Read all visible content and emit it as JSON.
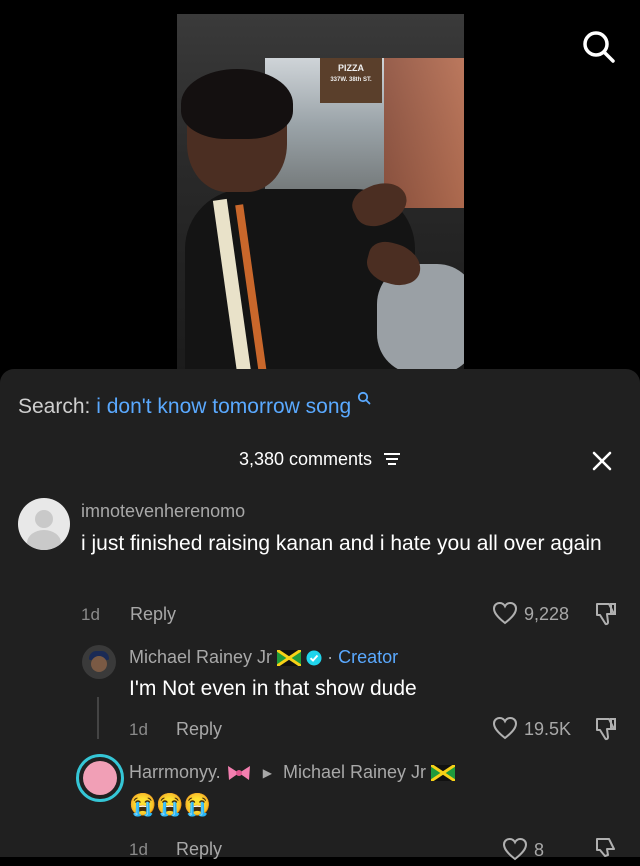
{
  "search": {
    "label": "Search:",
    "query": "i don't know tomorrow song"
  },
  "video": {
    "storefront_text": "PIZZA",
    "storefront_sub": "337W. 38th ST."
  },
  "header": {
    "comment_count": "3,380 comments"
  },
  "comments": [
    {
      "username": "imnotevenherenomo",
      "text": "i just finished raising kanan and i hate you all over again",
      "age": "1d",
      "reply_label": "Reply",
      "likes": "9,228"
    },
    {
      "username": "Michael Rainey Jr",
      "badge": "Creator",
      "text": "I'm Not even in that show dude",
      "age": "1d",
      "reply_label": "Reply",
      "likes": "19.5K"
    },
    {
      "username": "Harrmonyy.",
      "reply_to": "Michael Rainey Jr",
      "text": "😭😭😭",
      "age": "1d",
      "reply_label": "Reply",
      "likes": "8"
    }
  ],
  "icons": {
    "search": "search-icon",
    "sort": "sort-icon",
    "close": "close-icon",
    "heart": "heart-icon",
    "dislike": "dislike-icon",
    "verified": "verified-icon",
    "flag": "jamaica-flag-icon",
    "bow": "pink-bow-icon"
  },
  "colors": {
    "accent": "#5aa9ff",
    "sheet_bg": "#202020",
    "ring": "#35c6d6"
  }
}
